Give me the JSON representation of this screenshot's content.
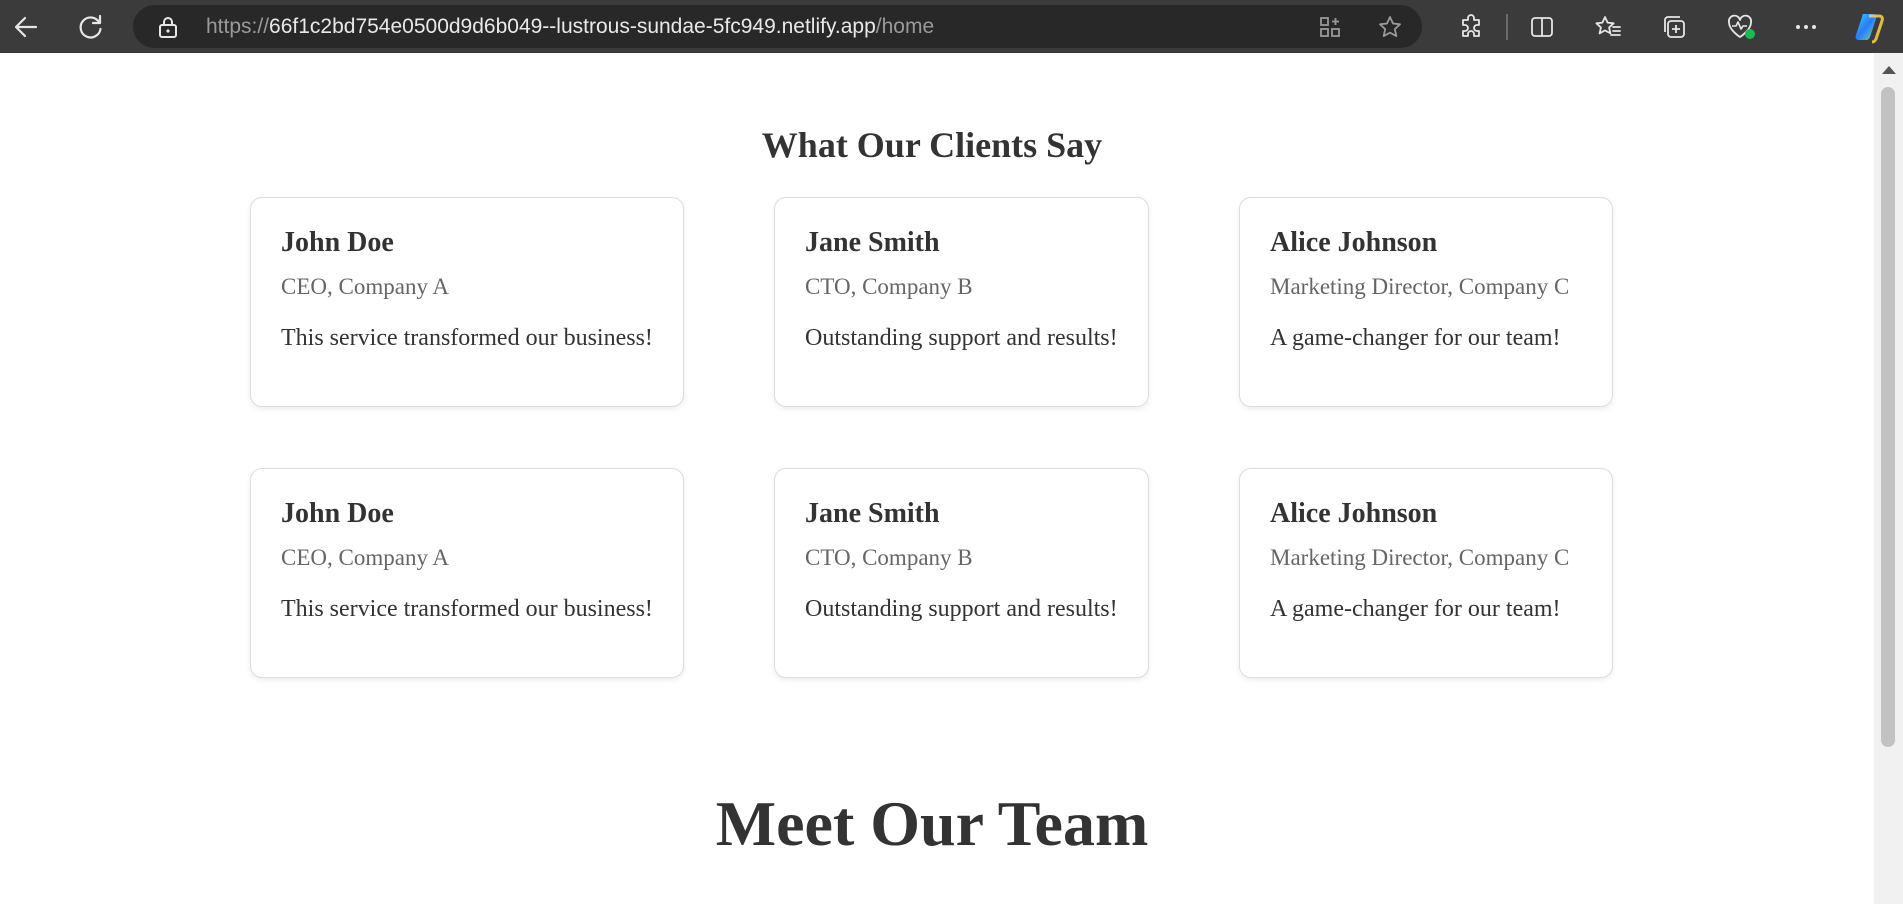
{
  "browser": {
    "url_scheme": "https://",
    "url_host": "66f1c2bd754e0500d9d6b049--lustrous-sundae-5fc949.netlify.app",
    "url_path": "/home"
  },
  "testimonials": {
    "title": "What Our Clients Say",
    "cards": [
      {
        "name": "John Doe",
        "role": "CEO, Company A",
        "quote": "This service transformed our business!"
      },
      {
        "name": "Jane Smith",
        "role": "CTO, Company B",
        "quote": "Outstanding support and results!"
      },
      {
        "name": "Alice Johnson",
        "role": "Marketing Director, Company C",
        "quote": "A game-changer for our team!"
      },
      {
        "name": "John Doe",
        "role": "CEO, Company A",
        "quote": "This service transformed our business!"
      },
      {
        "name": "Jane Smith",
        "role": "CTO, Company B",
        "quote": "Outstanding support and results!"
      },
      {
        "name": "Alice Johnson",
        "role": "Marketing Director, Company C",
        "quote": "A game-changer for our team!"
      }
    ]
  },
  "team": {
    "title": "Meet Our Team"
  },
  "colors": {
    "chrome_bg": "#3b3b3b",
    "address_bar_bg": "#282828",
    "text_primary": "#333333",
    "text_secondary": "#666666",
    "card_border": "#dddddd",
    "health_badge": "#1db954"
  },
  "icons": {
    "back": "back-arrow-icon",
    "refresh": "refresh-icon",
    "site_info": "lock-icon",
    "apps": "add-app-icon",
    "favorite": "star-icon",
    "extensions": "puzzle-icon",
    "split": "split-screen-icon",
    "favorites": "favorites-icon",
    "collections": "collections-icon",
    "health": "browser-essentials-icon",
    "more": "more-dots-icon",
    "copilot": "copilot-icon"
  }
}
